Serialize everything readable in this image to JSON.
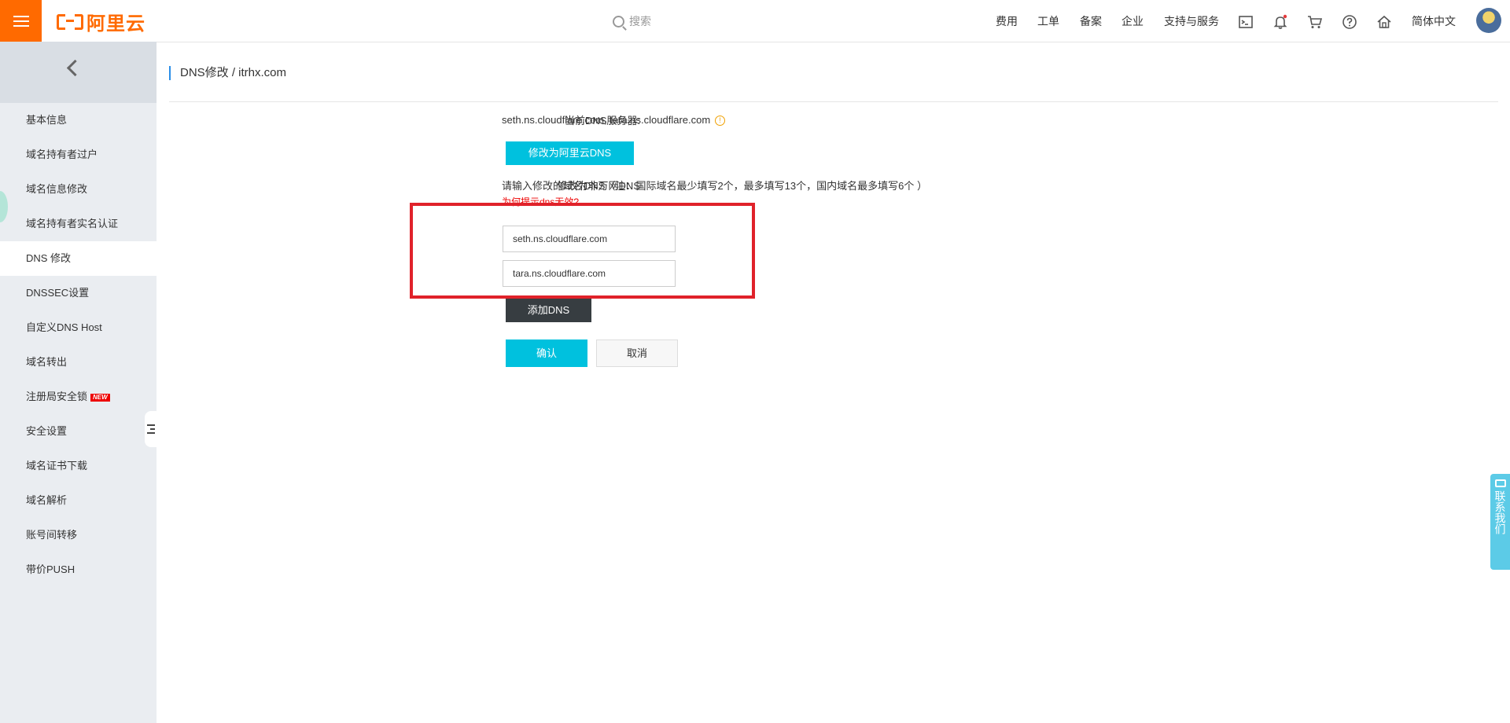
{
  "brand": {
    "logo_text": "阿里云",
    "accent": "#ff6a00"
  },
  "header": {
    "search_placeholder": "搜索",
    "nav": [
      "费用",
      "工单",
      "备案",
      "企业",
      "支持与服务"
    ],
    "language": "简体中文"
  },
  "sidebar": {
    "items": [
      {
        "label": "基本信息"
      },
      {
        "label": "域名持有者过户"
      },
      {
        "label": "域名信息修改"
      },
      {
        "label": "域名持有者实名认证"
      },
      {
        "label": "DNS 修改",
        "active": true
      },
      {
        "label": "DNSSEC设置"
      },
      {
        "label": "自定义DNS Host"
      },
      {
        "label": "域名转出"
      },
      {
        "label": "注册局安全锁",
        "badge": "NEW"
      },
      {
        "label": "安全设置"
      },
      {
        "label": "域名证书下载"
      },
      {
        "label": "域名解析"
      },
      {
        "label": "账号间转移"
      },
      {
        "label": "带价PUSH"
      }
    ]
  },
  "main": {
    "breadcrumb": "DNS修改 / itrhx.com",
    "current_dns_label": "当前DNS服务器:",
    "current_dns_value": "seth.ns.cloudflare.com, tara.ns.cloudflare.com",
    "modify_aliyun_btn": "修改为阿里云DNS",
    "non_wanwang_label": "修改为非万网DNS",
    "instruction": "请输入修改的域名DNS（注：国际域名最少填写2个，最多填写13个，国内域名最多填写6个 ）",
    "hint_link": "为何提示dns无效?",
    "dns_inputs": [
      "seth.ns.cloudflare.com",
      "tara.ns.cloudflare.com"
    ],
    "add_dns_btn": "添加DNS",
    "confirm_btn": "确认",
    "cancel_btn": "取消"
  },
  "contact": {
    "label": "联系我们"
  }
}
